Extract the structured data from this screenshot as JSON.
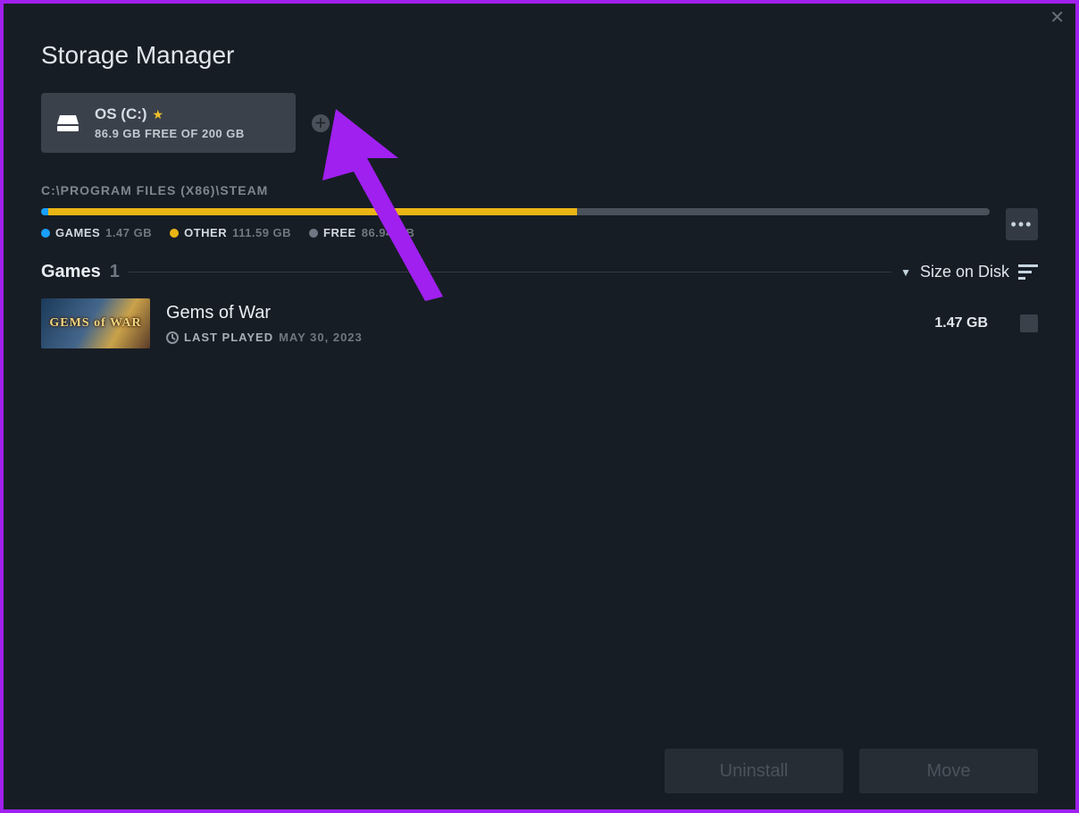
{
  "title": "Storage Manager",
  "drive": {
    "name": "OS (C:)",
    "sub": "86.9 GB FREE OF 200 GB",
    "is_default": true
  },
  "path": "C:\\PROGRAM FILES (X86)\\STEAM",
  "usage": {
    "total_gb": 200,
    "segments": [
      {
        "key": "games",
        "label": "GAMES",
        "value": "1.47 GB",
        "gb": 1.47
      },
      {
        "key": "other",
        "label": "OTHER",
        "value": "111.59 GB",
        "gb": 111.59
      },
      {
        "key": "free",
        "label": "FREE",
        "value": "86.94 GB",
        "gb": 86.94
      }
    ]
  },
  "games_header": {
    "label": "Games",
    "count": "1",
    "sort": "Size on Disk"
  },
  "games": [
    {
      "title": "Gems of War",
      "thumb_text": "GEMS of WAR",
      "last_played_label": "LAST PLAYED",
      "last_played_value": "MAY 30, 2023",
      "size": "1.47 GB"
    }
  ],
  "footer": {
    "uninstall": "Uninstall",
    "move": "Move"
  }
}
